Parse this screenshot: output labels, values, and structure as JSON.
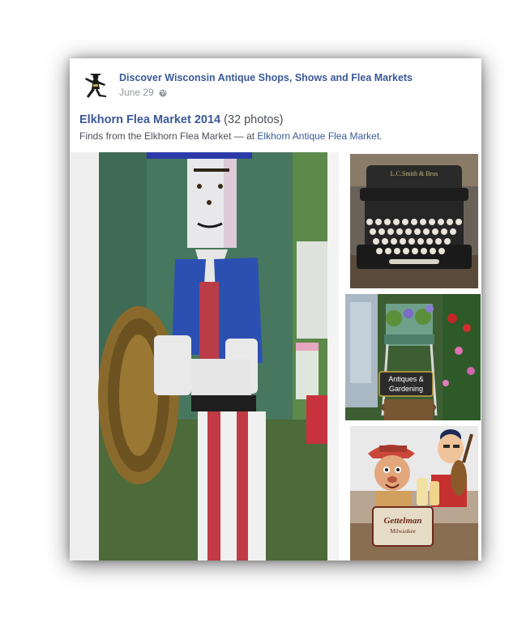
{
  "post": {
    "page_name": "Discover Wisconsin Antique Shops, Shows and Flea Markets",
    "date": "June 29",
    "privacy_icon": "globe-icon",
    "avatar_icon": "dancing-figure-icon"
  },
  "album": {
    "title": "Elkhorn Flea Market 2014",
    "photo_count": "(32 photos)",
    "caption_prefix": "Finds from the Elkhorn Flea Market — at ",
    "location": "Elkhorn Antique Flea Market",
    "caption_suffix": "."
  },
  "photos": {
    "sign_text_1": "Antiques &",
    "sign_text_2": "Gardening",
    "typewriter_brand": "L.C.Smith & Bros",
    "bottle_brand": "Gettelman",
    "bottle_sub": "Milwaukee"
  },
  "colors": {
    "link": "#3b5998",
    "meta": "#90949c",
    "text": "#4b4f56"
  }
}
